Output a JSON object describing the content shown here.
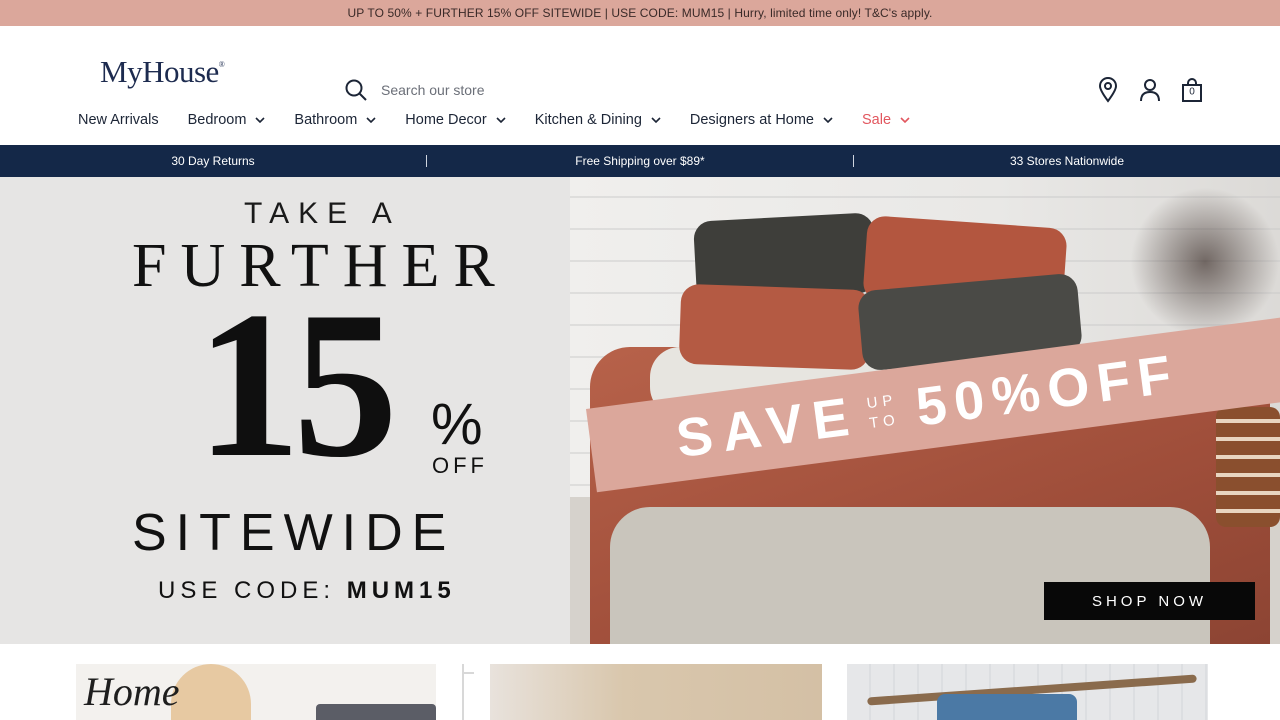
{
  "promo_bar": {
    "text": "UP TO 50% + FURTHER 15% OFF SITEWIDE | USE CODE: MUM15 | Hurry, limited time only! T&C's apply."
  },
  "header": {
    "logo": "MyHouse",
    "logo_mark": "®",
    "search_placeholder": "Search our store",
    "cart_count": "0",
    "icons": [
      "search-icon",
      "location-pin-icon",
      "account-icon",
      "cart-bag-icon"
    ]
  },
  "nav": {
    "items": [
      {
        "label": "New Arrivals",
        "has_dropdown": false
      },
      {
        "label": "Bedroom",
        "has_dropdown": true
      },
      {
        "label": "Bathroom",
        "has_dropdown": true
      },
      {
        "label": "Home Decor",
        "has_dropdown": true
      },
      {
        "label": "Kitchen & Dining",
        "has_dropdown": true
      },
      {
        "label": "Designers at Home",
        "has_dropdown": true
      },
      {
        "label": "Sale",
        "has_dropdown": true
      }
    ]
  },
  "usp_bar": {
    "items": [
      "30 Day Returns",
      "Free Shipping over $89*",
      "33 Stores Nationwide"
    ],
    "separator": "|"
  },
  "hero": {
    "take_a": "TAKE A",
    "further": "FURTHER",
    "number": "15",
    "percent": "%",
    "off": "OFF",
    "sitewide": "SITEWIDE",
    "code_label": "USE CODE:",
    "code": "MUM15",
    "save": "SAVE",
    "up": "UP",
    "to": "TO",
    "fifty": "50%OFF",
    "cta": "SHOP NOW"
  },
  "tiles": {
    "tile1_script": "Home"
  },
  "colors": {
    "promo_bg": "#dba79b",
    "usp_bg": "#142848",
    "sale_red": "#e2575f",
    "logo_navy": "#1d2b4f"
  }
}
